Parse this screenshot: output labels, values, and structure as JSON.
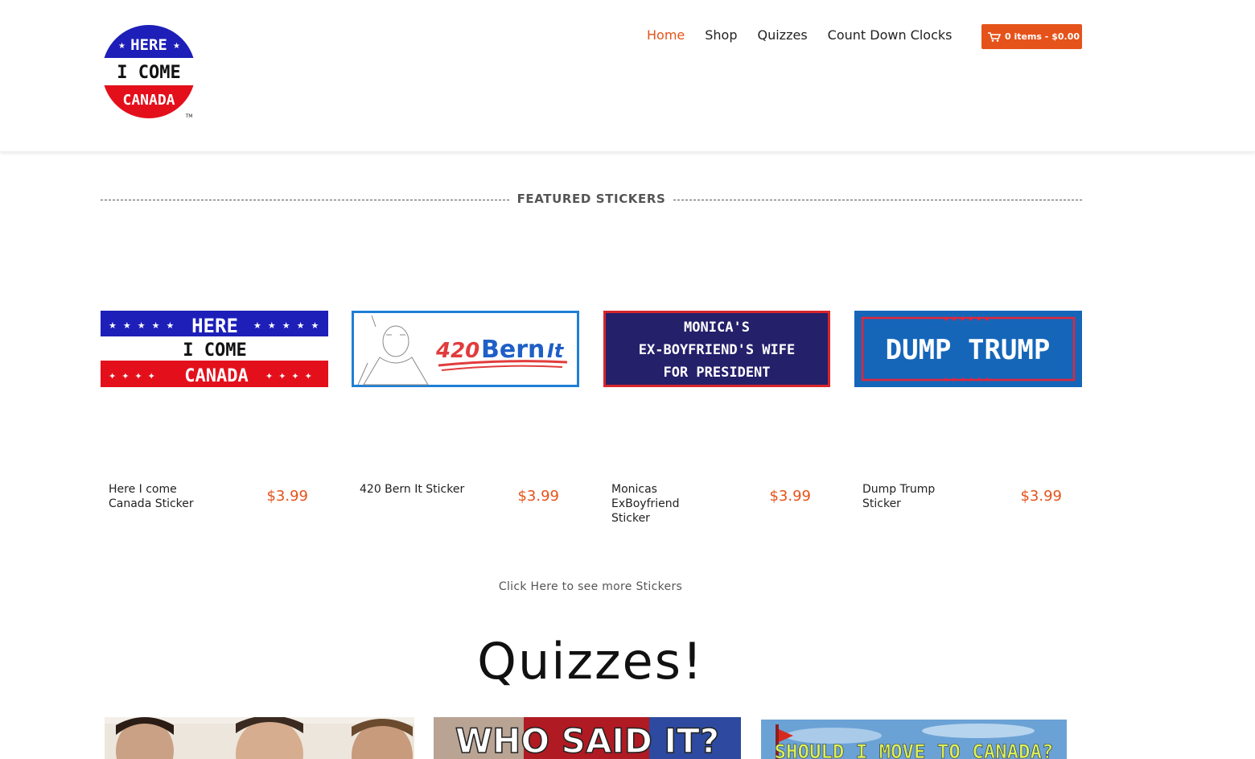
{
  "header": {
    "logo": {
      "line1": "HERE",
      "line2": "I COME",
      "line3": "CANADA",
      "tm": "TM",
      "colors": {
        "blue": "#1d1fb8",
        "red": "#e3101c"
      }
    },
    "nav": [
      {
        "label": "Home",
        "active": true
      },
      {
        "label": "Shop",
        "active": false
      },
      {
        "label": "Quizzes",
        "active": false
      },
      {
        "label": "Count Down Clocks",
        "active": false
      }
    ],
    "cart": {
      "label": "0 items - $0.00",
      "icon": "cart-icon",
      "color": "#e5531a"
    }
  },
  "featured": {
    "title": "FEATURED STICKERS",
    "products": [
      {
        "name": "Here I come Canada Sticker",
        "price": "$3.99",
        "sticker": {
          "line1": "HERE",
          "line2": "I COME",
          "line3": "CANADA"
        }
      },
      {
        "name": "420 Bern It Sticker",
        "price": "$3.99",
        "sticker": {
          "num": "420",
          "word": "Bern",
          "suffix": "It"
        }
      },
      {
        "name": "Monicas ExBoyfriend Sticker",
        "price": "$3.99",
        "sticker": {
          "line1": "MONICA'S",
          "line2": "EX-BOYFRIEND'S WIFE",
          "line3": "FOR PRESIDENT"
        }
      },
      {
        "name": "Dump Trump Sticker",
        "price": "$3.99",
        "sticker": {
          "text": "DUMP TRUMP"
        }
      }
    ],
    "more_link": "Click Here to see more Stickers"
  },
  "quizzes": {
    "title": "Quizzes!",
    "items": [
      {
        "banner": ""
      },
      {
        "banner": "WHO SAID IT?"
      },
      {
        "banner": "SHOULD I MOVE TO CANADA?"
      }
    ]
  },
  "colors": {
    "accent": "#e5531a",
    "sticker_blue": "#1d1fb8",
    "sticker_red": "#e3101c",
    "navy": "#24206a",
    "trump_blue": "#1566b9"
  }
}
